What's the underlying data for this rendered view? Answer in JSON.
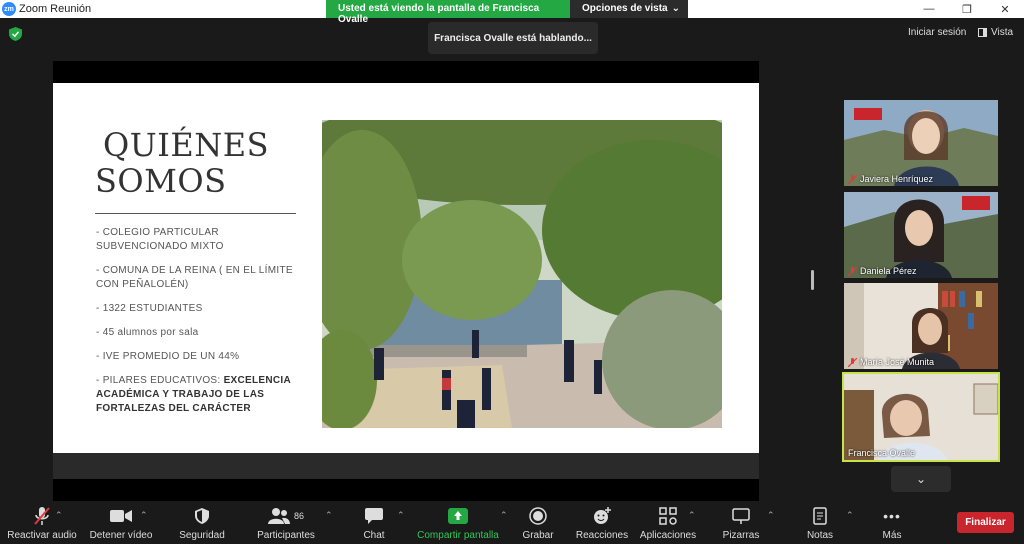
{
  "window": {
    "title": "Zoom Reunión",
    "logo_text": "zm"
  },
  "share_banner": {
    "status": "Usted está viendo la pantalla de Francisca Ovalle",
    "view_options": "Opciones de vista"
  },
  "speaking_notice": "Francisca Ovalle está hablando...",
  "top_right": {
    "signin": "Iniciar sesión",
    "view": "Vista"
  },
  "slide": {
    "title_line1": "QUIÉNES",
    "title_line2": "SOMOS",
    "bullets": [
      "- COLEGIO PARTICULAR SUBVENCIONADO MIXTO",
      "- COMUNA DE LA REINA ( EN EL LÍMITE CON PEÑALOLÉN)",
      "- 1322 ESTUDIANTES",
      "- 45 alumnos por sala",
      "- IVE PROMEDIO DE UN 44%"
    ],
    "last_bullet_prefix": "- PILARES EDUCATIVOS: ",
    "last_bullet_bold": "EXCELENCIA ACADÉMICA Y TRABAJO DE LAS FORTALEZAS DEL CARÁCTER"
  },
  "participants": [
    {
      "name": "Javiera Henríquez",
      "muted": true
    },
    {
      "name": "Daniela Pérez",
      "muted": true
    },
    {
      "name": "María José Munita",
      "muted": true
    },
    {
      "name": "Francisca Ovalle",
      "muted": false,
      "active_speaker": true
    }
  ],
  "toolbar": {
    "audio": "Reactivar audio",
    "video": "Detener vídeo",
    "security": "Seguridad",
    "participants": "Participantes",
    "participants_count": "86",
    "chat": "Chat",
    "share": "Compartir pantalla",
    "record": "Grabar",
    "reactions": "Reacciones",
    "apps": "Aplicaciones",
    "whiteboards": "Pizarras",
    "notes": "Notas",
    "more": "Más",
    "end": "Finalizar"
  },
  "colors": {
    "share_green": "#23a844",
    "end_red": "#c8252c",
    "speaker_border": "#c6e34a"
  }
}
